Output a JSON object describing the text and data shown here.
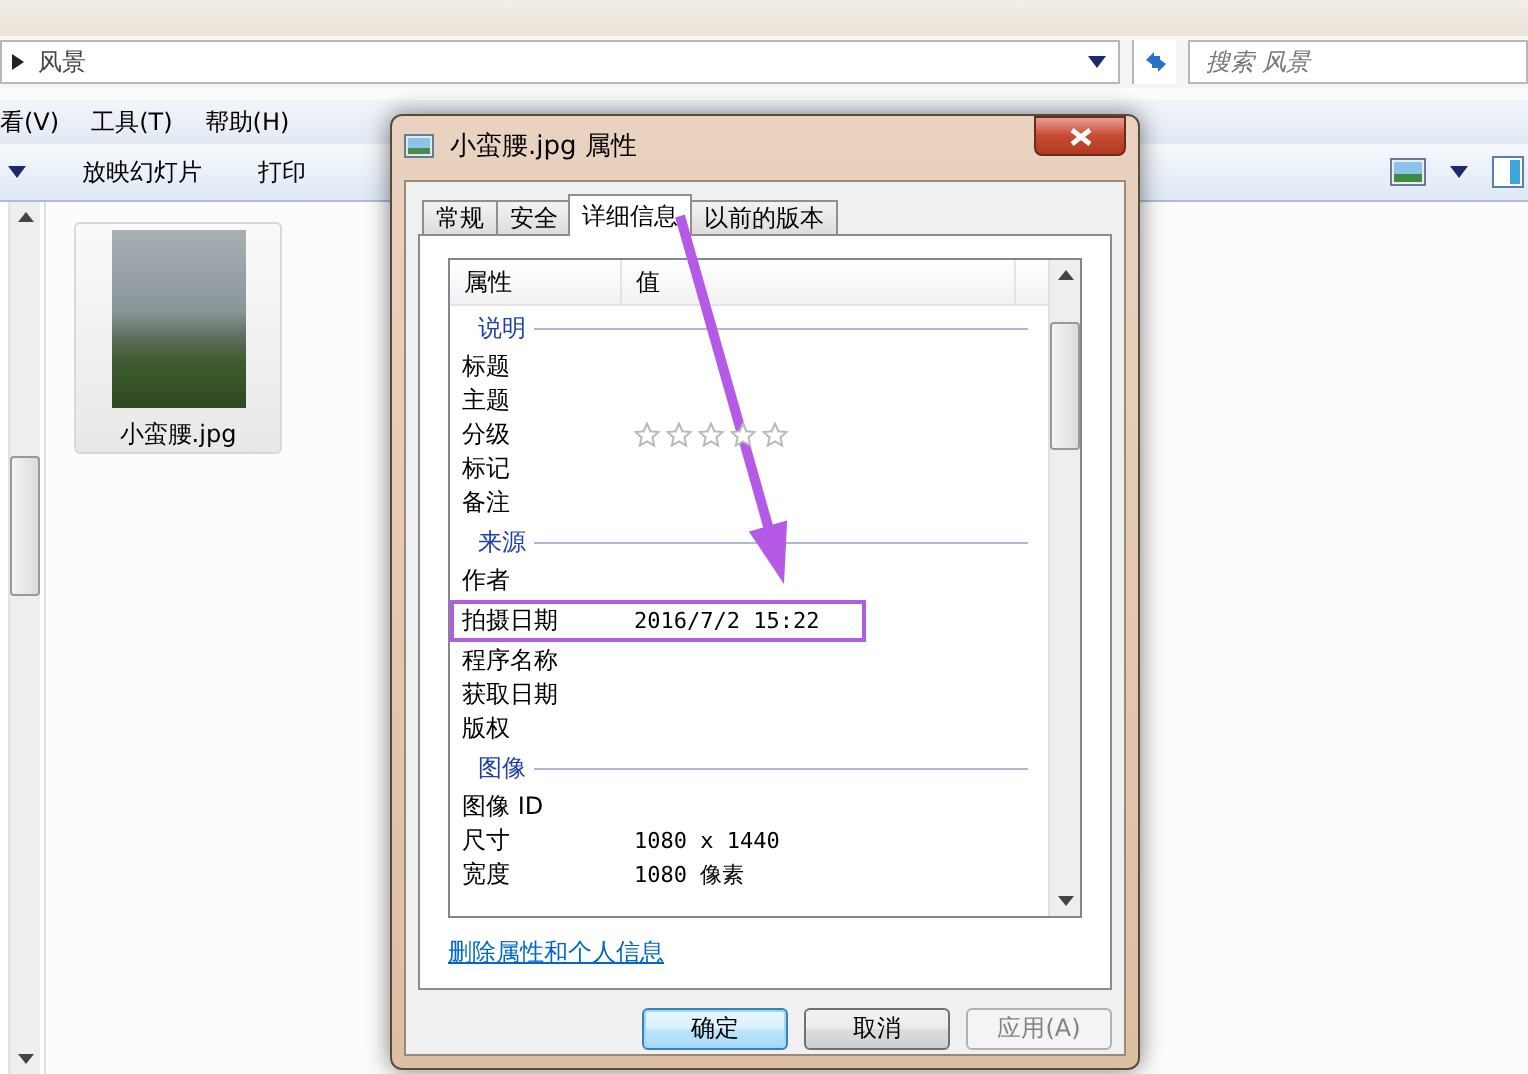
{
  "explorer": {
    "breadcrumb": "风景",
    "search": {
      "placeholder": "搜索 风景"
    },
    "menu": [
      "看(V)",
      "工具(T)",
      "帮助(H)"
    ],
    "toolbar": [
      "放映幻灯片",
      "打印"
    ],
    "files": [
      {
        "name": "小蛮腰.jpg"
      }
    ]
  },
  "dialog": {
    "title": "小蛮腰.jpg 属性",
    "tabs": [
      {
        "label": "常规",
        "selected": false
      },
      {
        "label": "安全",
        "selected": false
      },
      {
        "label": "详细信息",
        "selected": true
      },
      {
        "label": "以前的版本",
        "selected": false
      }
    ],
    "columns": [
      "属性",
      "值"
    ],
    "rows": [
      {
        "kind": "group",
        "label": "说明"
      },
      {
        "kind": "property",
        "name": "标题",
        "highlighted": false
      },
      {
        "kind": "property",
        "name": "主题",
        "highlighted": false
      },
      {
        "kind": "rating",
        "name": "分级",
        "stars": 0,
        "highlighted": false
      },
      {
        "kind": "property",
        "name": "标记",
        "highlighted": false
      },
      {
        "kind": "property",
        "name": "备注",
        "highlighted": false
      },
      {
        "kind": "group",
        "label": "来源"
      },
      {
        "kind": "property",
        "name": "作者",
        "highlighted": false
      },
      {
        "kind": "property",
        "name": "拍摄日期",
        "value": "2016/7/2 15:22",
        "highlighted": true
      },
      {
        "kind": "property",
        "name": "程序名称",
        "highlighted": false
      },
      {
        "kind": "property",
        "name": "获取日期",
        "highlighted": false
      },
      {
        "kind": "property",
        "name": "版权",
        "highlighted": false
      },
      {
        "kind": "group",
        "label": "图像"
      },
      {
        "kind": "property",
        "name": "图像 ID",
        "highlighted": false
      },
      {
        "kind": "property",
        "name": "尺寸",
        "value": "1080 x 1440",
        "highlighted": false
      },
      {
        "kind": "property",
        "name": "宽度",
        "value": "1080 像素",
        "highlighted": false
      }
    ],
    "link": "删除属性和个人信息",
    "buttons": [
      {
        "label": "确定",
        "default": true,
        "disabled": false
      },
      {
        "label": "取消",
        "default": false,
        "disabled": false
      },
      {
        "label": "应用(A)",
        "default": false,
        "disabled": true
      }
    ]
  }
}
